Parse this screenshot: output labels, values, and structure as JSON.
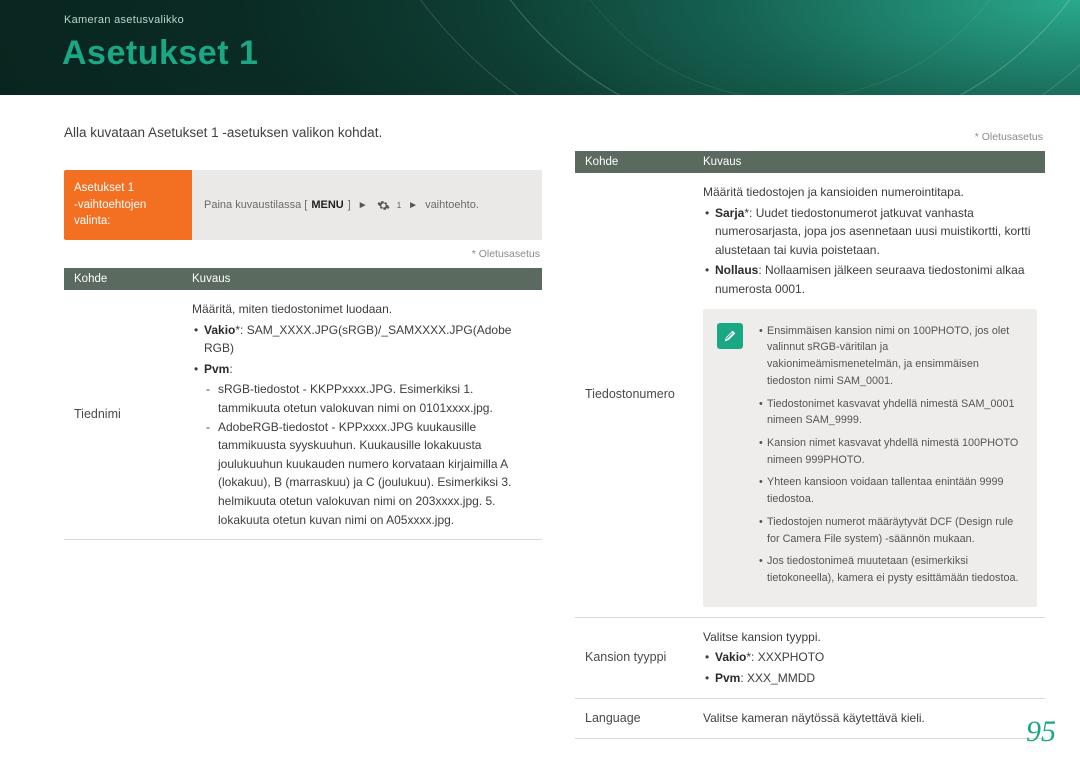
{
  "header": {
    "crumb": "Kameran asetusvalikko",
    "title": "Asetukset 1"
  },
  "left": {
    "intro": "Alla kuvataan Asetukset 1 -asetuksen valikon kohdat.",
    "instr_label_1": "Asetukset 1",
    "instr_label_2": "-vaihtoehtojen",
    "instr_label_3": "valinta:",
    "instr_prefix": "Paina kuvaustilassa [",
    "instr_menu": "MENU",
    "instr_mid": "] ",
    "instr_gear_sub": "1",
    "instr_suffix": " vaihtoehto.",
    "footnote": "* Oletusasetus",
    "th_kohde": "Kohde",
    "th_kuvaus": "Kuvaus",
    "row1_kohde": "Tiednimi",
    "row1_line1": "Määritä, miten tiedostonimet luodaan.",
    "row1_b1_term": "Vakio",
    "row1_b1_rest": "*: SAM_XXXX.JPG(sRGB)/_SAMXXXX.JPG(Adobe RGB)",
    "row1_b2_term": "Pvm",
    "row1_b2_rest": ":",
    "row1_d1": "sRGB-tiedostot - KKPPxxxx.JPG. Esimerkiksi 1. tammikuuta otetun valokuvan nimi on 0101xxxx.jpg.",
    "row1_d2": "AdobeRGB-tiedostot - KPPxxxx.JPG kuukausille tammikuusta syyskuuhun. Kuukausille lokakuusta joulukuuhun kuukauden numero korvataan kirjaimilla A (lokakuu), B (marraskuu) ja C (joulukuu). Esimerkiksi 3. helmikuuta otetun valokuvan nimi on 203xxxx.jpg. 5. lokakuuta otetun kuvan nimi on A05xxxx.jpg."
  },
  "right": {
    "footnote": "* Oletusasetus",
    "th_kohde": "Kohde",
    "th_kuvaus": "Kuvaus",
    "r1_kohde": "Tiedostonumero",
    "r1_line1": "Määritä tiedostojen ja kansioiden numerointitapa.",
    "r1_b1_term": "Sarja",
    "r1_b1_rest": "*: Uudet tiedostonumerot jatkuvat vanhasta numerosarjasta, jopa jos asennetaan uusi muistikortti, kortti alustetaan tai kuvia poistetaan.",
    "r1_b2_term": "Nollaus",
    "r1_b2_rest": ": Nollaamisen jälkeen seuraava tiedostonimi alkaa numerosta 0001.",
    "note_items": [
      "Ensimmäisen kansion nimi on 100PHOTO, jos olet valinnut sRGB-väritilan ja vakionimeämismenetelmän, ja ensimmäisen tiedoston nimi SAM_0001.",
      "Tiedostonimet kasvavat yhdellä nimestä SAM_0001 nimeen SAM_9999.",
      "Kansion nimet kasvavat yhdellä nimestä 100PHOTO nimeen 999PHOTO.",
      "Yhteen kansioon voidaan tallentaa enintään 9999 tiedostoa.",
      "Tiedostojen numerot määräytyvät DCF (Design rule for Camera File system) -säännön mukaan.",
      "Jos tiedostonimeä muutetaan (esimerkiksi tietokoneella), kamera ei pysty esittämään tiedostoa."
    ],
    "r2_kohde": "Kansion tyyppi",
    "r2_line1": "Valitse kansion tyyppi.",
    "r2_b1_term": "Vakio",
    "r2_b1_rest": "*: XXXPHOTO",
    "r2_b2_term": "Pvm",
    "r2_b2_rest": ": XXX_MMDD",
    "r3_kohde": "Language",
    "r3_desc": "Valitse kameran näytössä käytettävä kieli."
  },
  "pageno": "95"
}
